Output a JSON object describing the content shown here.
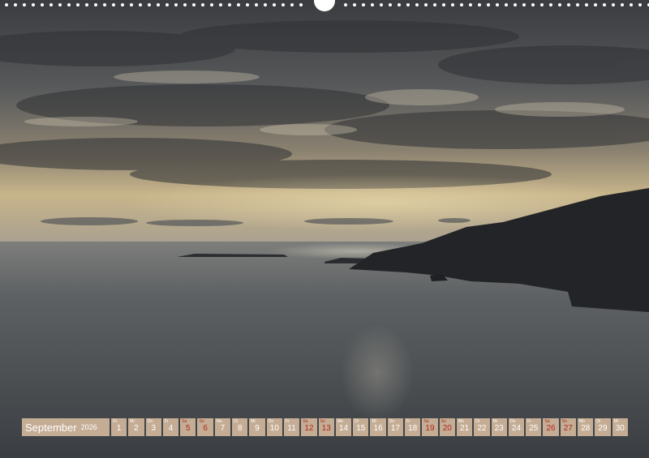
{
  "calendar": {
    "month": "September",
    "year": "2026",
    "days": [
      {
        "num": "1",
        "wd": "Di",
        "weekend": false
      },
      {
        "num": "2",
        "wd": "Mi",
        "weekend": false
      },
      {
        "num": "3",
        "wd": "Do",
        "weekend": false
      },
      {
        "num": "4",
        "wd": "Fr",
        "weekend": false
      },
      {
        "num": "5",
        "wd": "Sa",
        "weekend": true
      },
      {
        "num": "6",
        "wd": "So",
        "weekend": true
      },
      {
        "num": "7",
        "wd": "Mo",
        "weekend": false
      },
      {
        "num": "8",
        "wd": "Di",
        "weekend": false
      },
      {
        "num": "9",
        "wd": "Mi",
        "weekend": false
      },
      {
        "num": "10",
        "wd": "Do",
        "weekend": false
      },
      {
        "num": "11",
        "wd": "Fr",
        "weekend": false
      },
      {
        "num": "12",
        "wd": "Sa",
        "weekend": true
      },
      {
        "num": "13",
        "wd": "So",
        "weekend": true
      },
      {
        "num": "14",
        "wd": "Mo",
        "weekend": false
      },
      {
        "num": "15",
        "wd": "Di",
        "weekend": false
      },
      {
        "num": "16",
        "wd": "Mi",
        "weekend": false
      },
      {
        "num": "17",
        "wd": "Do",
        "weekend": false
      },
      {
        "num": "18",
        "wd": "Fr",
        "weekend": false
      },
      {
        "num": "19",
        "wd": "Sa",
        "weekend": true
      },
      {
        "num": "20",
        "wd": "So",
        "weekend": true
      },
      {
        "num": "21",
        "wd": "Mo",
        "weekend": false
      },
      {
        "num": "22",
        "wd": "Di",
        "weekend": false
      },
      {
        "num": "23",
        "wd": "Mi",
        "weekend": false
      },
      {
        "num": "24",
        "wd": "Do",
        "weekend": false
      },
      {
        "num": "25",
        "wd": "Fr",
        "weekend": false
      },
      {
        "num": "26",
        "wd": "Sa",
        "weekend": true
      },
      {
        "num": "27",
        "wd": "So",
        "weekend": true
      },
      {
        "num": "28",
        "wd": "Mo",
        "weekend": false
      },
      {
        "num": "29",
        "wd": "Di",
        "weekend": false
      },
      {
        "num": "30",
        "wd": "Mi",
        "weekend": false
      }
    ]
  },
  "colors": {
    "cell_bg": "#c4ad94",
    "weekend_text": "#b3261e",
    "weekday_text": "#ffffff"
  },
  "photo": {
    "icon": "seascape-sunset-photo"
  }
}
